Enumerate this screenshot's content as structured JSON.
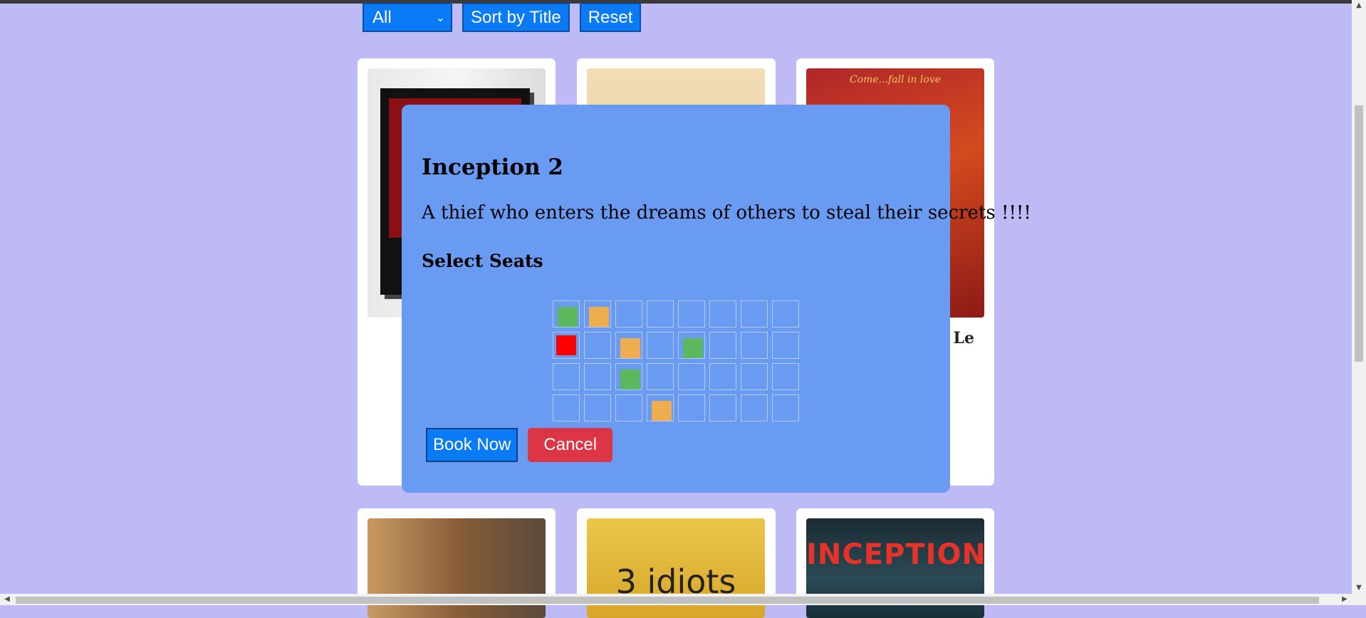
{
  "controls": {
    "filter_value": "All",
    "sort_label": "Sort by Title",
    "reset_label": "Reset"
  },
  "cards": [
    {
      "title": ""
    },
    {
      "title": ""
    },
    {
      "title": "Le"
    },
    {
      "title": ""
    },
    {
      "title": "3 idiots"
    },
    {
      "title": "INCEPTION"
    }
  ],
  "poster_text": {
    "card3_tagline": "Come...fall in love"
  },
  "modal": {
    "title": "Inception 2",
    "description": "A thief who enters the dreams of others to steal their secrets !!!!",
    "seats_heading": "Select Seats",
    "book_label": "Book Now",
    "cancel_label": "Cancel",
    "seat_rows": [
      [
        "available",
        "selected",
        "empty",
        "empty",
        "empty",
        "empty",
        "empty",
        "empty"
      ],
      [
        "booked",
        "empty",
        "selected",
        "empty",
        "available",
        "empty",
        "empty",
        "empty"
      ],
      [
        "empty",
        "empty",
        "available",
        "empty",
        "empty",
        "empty",
        "empty",
        "empty"
      ],
      [
        "empty",
        "empty",
        "empty",
        "selected",
        "empty",
        "empty",
        "empty",
        "empty"
      ]
    ]
  },
  "colors": {
    "background": "#bdbaf6",
    "modal": "#6a9bf2",
    "primary_button": "#0a7bf4",
    "danger_button": "#dc3545",
    "seat_available": "#5cb85c",
    "seat_selected": "#f0ad4e",
    "seat_booked": "#ff0000"
  }
}
